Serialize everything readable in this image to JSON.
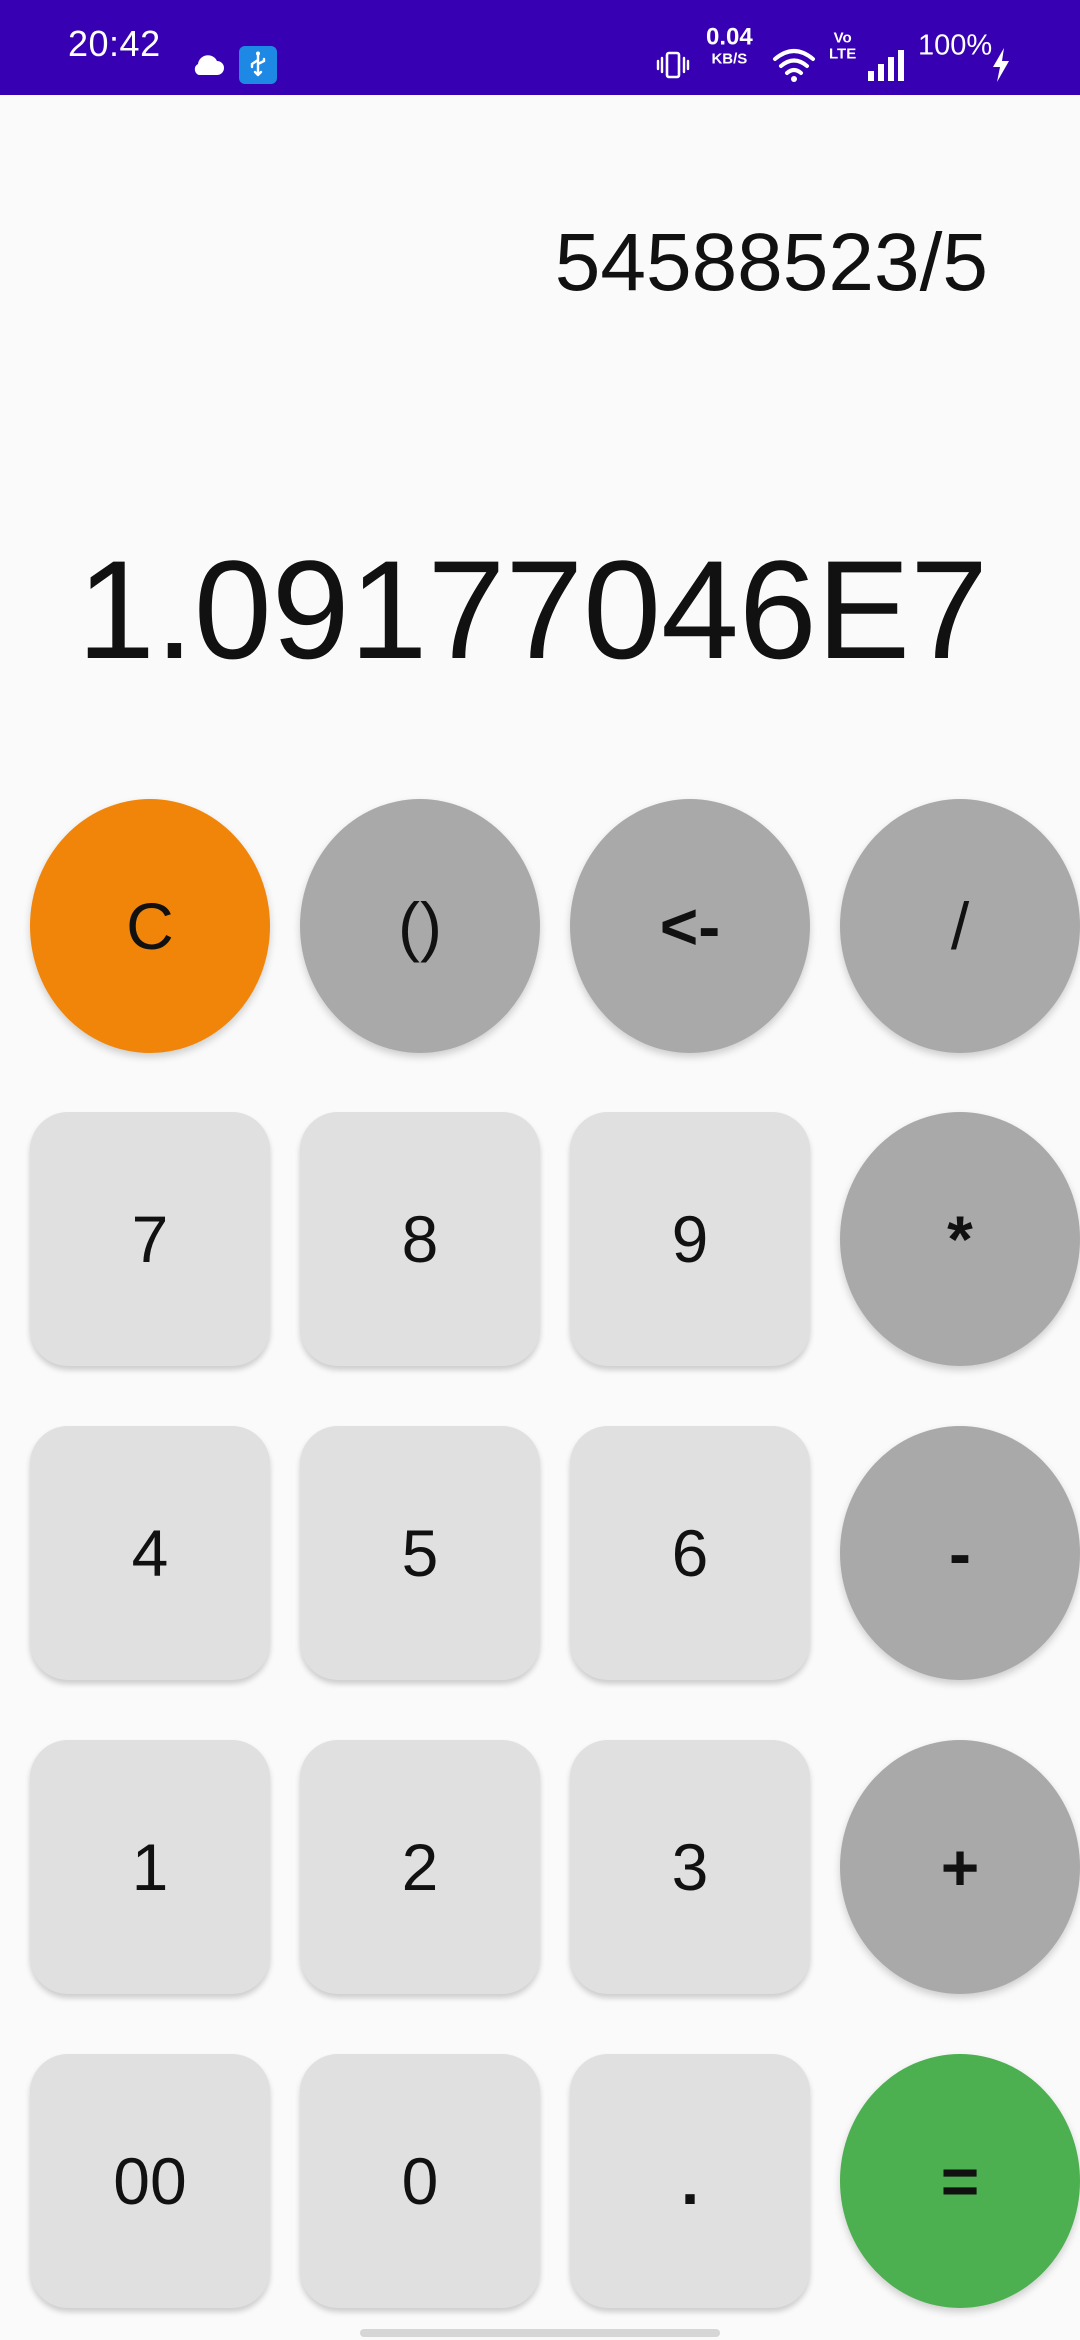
{
  "status_bar": {
    "time": "20:42",
    "net_speed_value": "0.04",
    "net_speed_unit": "KB/S",
    "volte_top": "Vo",
    "volte_bottom": "LTE",
    "battery": "100%",
    "icons": [
      "cloud-icon",
      "usb-icon",
      "vibrate-icon",
      "wifi-icon",
      "signal-icon",
      "charging-icon"
    ],
    "background_color": "#3700b3"
  },
  "display": {
    "expression": "54588523/5",
    "result": "1.09177046E7"
  },
  "keypad": {
    "row1": [
      {
        "label": "C",
        "style": "orange"
      },
      {
        "label": "()",
        "style": "gray"
      },
      {
        "label": "<-",
        "style": "gray"
      },
      {
        "label": "/",
        "style": "gray"
      }
    ],
    "row2": [
      {
        "label": "7",
        "style": "light"
      },
      {
        "label": "8",
        "style": "light"
      },
      {
        "label": "9",
        "style": "light"
      },
      {
        "label": "*",
        "style": "gray"
      }
    ],
    "row3": [
      {
        "label": "4",
        "style": "light"
      },
      {
        "label": "5",
        "style": "light"
      },
      {
        "label": "6",
        "style": "light"
      },
      {
        "label": "-",
        "style": "gray"
      }
    ],
    "row4": [
      {
        "label": "1",
        "style": "light"
      },
      {
        "label": "2",
        "style": "light"
      },
      {
        "label": "3",
        "style": "light"
      },
      {
        "label": "+",
        "style": "gray"
      }
    ],
    "row5": [
      {
        "label": "00",
        "style": "light"
      },
      {
        "label": "0",
        "style": "light"
      },
      {
        "label": ".",
        "style": "light"
      },
      {
        "label": "=",
        "style": "green"
      }
    ]
  },
  "colors": {
    "clear_key": "#f0850a",
    "operator_key": "#a9a9a9",
    "digit_key": "#e0e0e0",
    "equals_key": "#4caf50",
    "background": "#fafafa"
  }
}
